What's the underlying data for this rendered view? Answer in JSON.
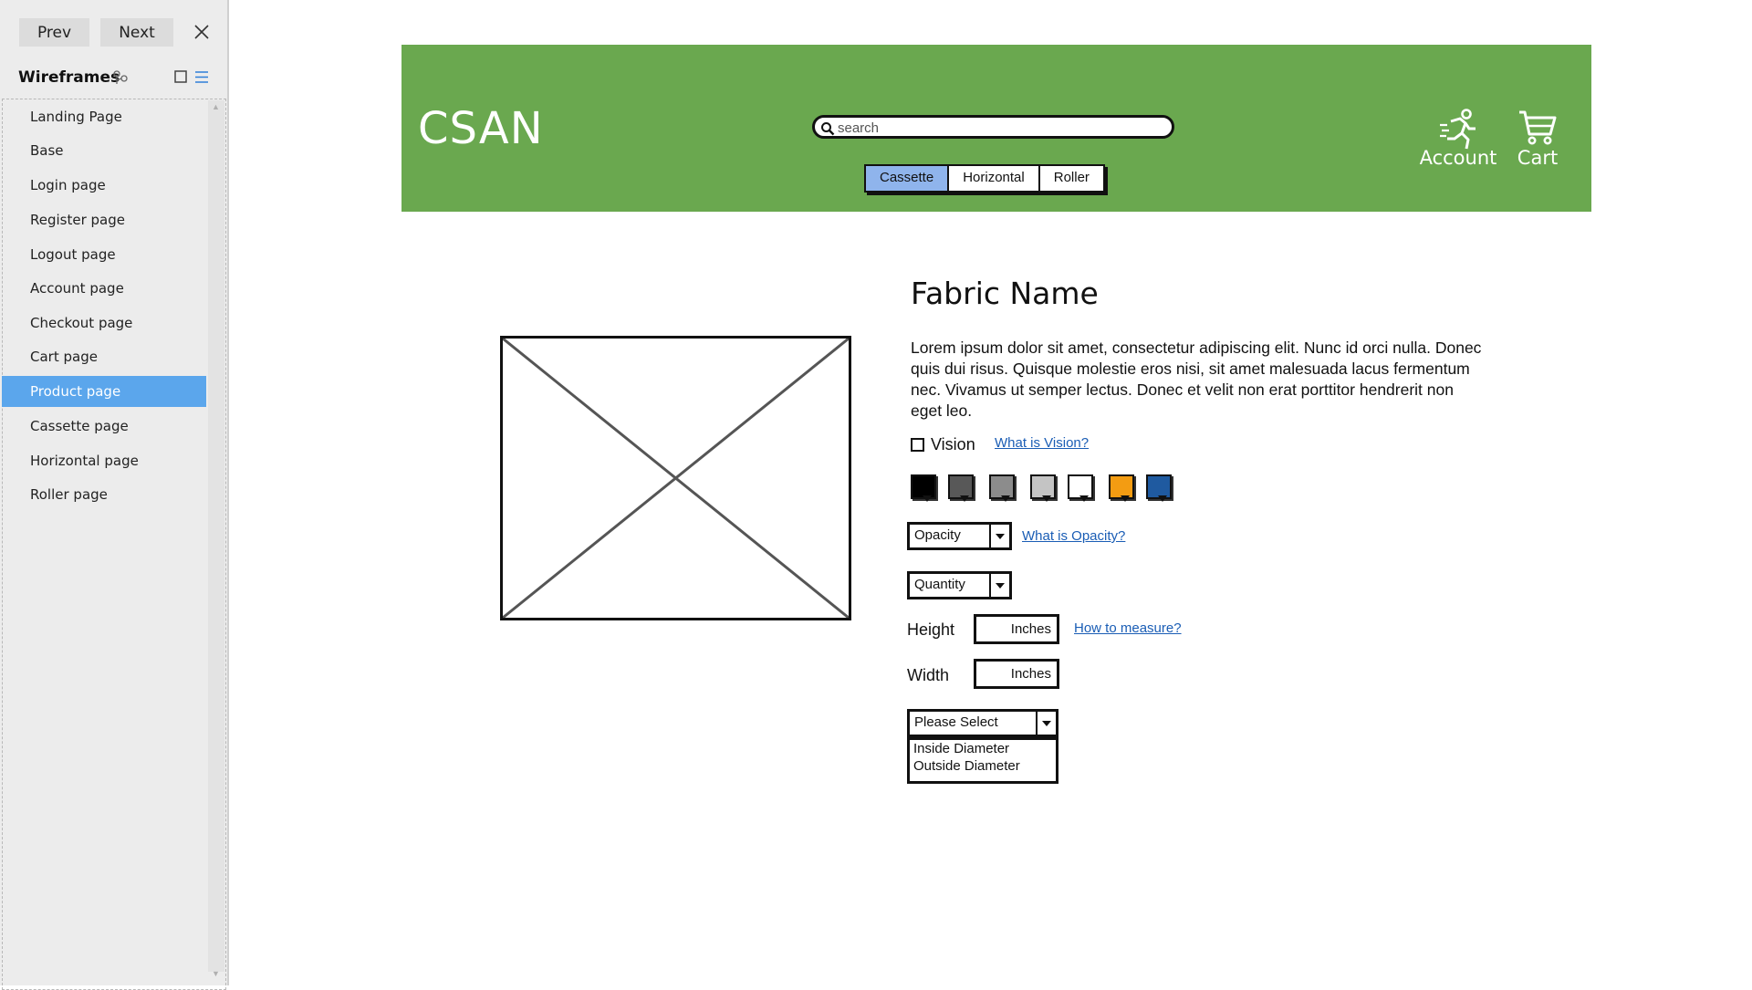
{
  "sidebar": {
    "prev_label": "Prev",
    "next_label": "Next",
    "panel_title": "Wireframes",
    "pages": [
      {
        "label": "Landing Page"
      },
      {
        "label": "Base"
      },
      {
        "label": "Login page"
      },
      {
        "label": "Register page"
      },
      {
        "label": "Logout page"
      },
      {
        "label": "Account page"
      },
      {
        "label": "Checkout page"
      },
      {
        "label": "Cart page"
      },
      {
        "label": "Product page"
      },
      {
        "label": "Cassette page"
      },
      {
        "label": "Horizontal page"
      },
      {
        "label": "Roller page"
      }
    ],
    "active_page": "Product page"
  },
  "header": {
    "logo": "CSAN",
    "search_placeholder": "search",
    "tabs": [
      "Cassette",
      "Horizontal",
      "Roller"
    ],
    "selected_tab": "Cassette",
    "account_label": "Account",
    "cart_label": "Cart",
    "background_color": "#6aa84f"
  },
  "product": {
    "title": "Fabric Name",
    "description": "Lorem ipsum dolor sit amet, consectetur adipiscing elit. Nunc id orci nulla. Donec quis dui risus. Quisque molestie eros nisi, sit amet malesuada lacus fermentum nec. Vivamus ut semper lectus. Donec et velit non erat porttitor hendrerit non eget leo.",
    "vision_label": "Vision",
    "vision_checked": false,
    "vision_link": "What is Vision?",
    "swatches": [
      "#000000",
      "#585858",
      "#8c8c8c",
      "#c4c4c4",
      "#ffffff",
      "#f39c12",
      "#1f5aa0"
    ],
    "opacity_label": "Opacity",
    "opacity_link": "What is Opacity?",
    "quantity_label": "Quantity",
    "height_label": "Height",
    "height_value": "Inches",
    "measure_link": "How to measure?",
    "width_label": "Width",
    "width_value": "Inches",
    "select_label": "Please Select",
    "select_options": [
      "Inside Diameter",
      "Outside Diameter"
    ]
  }
}
